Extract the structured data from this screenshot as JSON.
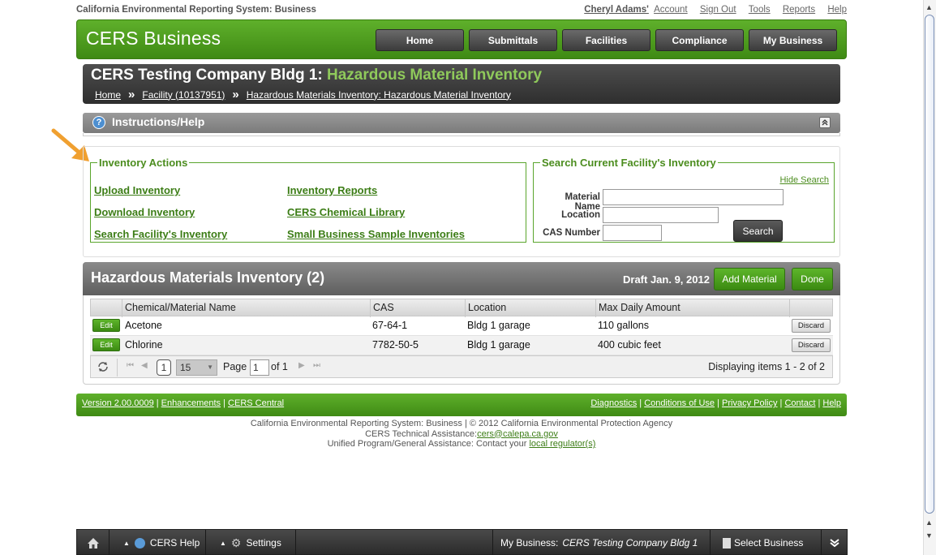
{
  "topbar": {
    "system": "California Environmental Reporting System: Business",
    "user_name": "Cheryl Adams'",
    "account": "Account",
    "sign_out": "Sign Out",
    "tools": "Tools",
    "reports": "Reports",
    "help": "Help"
  },
  "header": {
    "logo": "CERS Business",
    "nav": [
      "Home",
      "Submittals",
      "Facilities",
      "Compliance",
      "My Business"
    ]
  },
  "title": {
    "prefix": "CERS Testing Company Bldg 1:",
    "highlight": "Hazardous Material Inventory",
    "breadcrumb": [
      "Home",
      "Facility (10137951)",
      "Hazardous Materials Inventory: Hazardous Material Inventory"
    ],
    "sep": "»"
  },
  "instructions": {
    "label": "Instructions/Help",
    "q": "?",
    "collapse": "«"
  },
  "inventory_actions": {
    "legend": "Inventory Actions",
    "links": [
      "Upload Inventory",
      "Inventory Reports",
      "Download Inventory",
      "CERS Chemical Library",
      "Search Facility's Inventory",
      "Small Business Sample Inventories"
    ]
  },
  "search": {
    "legend": "Search Current Facility's Inventory",
    "hide": "Hide Search",
    "material_label": "Material Name",
    "location_label": "Location",
    "cas_label": "CAS Number",
    "button": "Search"
  },
  "inventory": {
    "title": "Hazardous Materials Inventory (2)",
    "draft": "Draft Jan. 9, 2012",
    "add_material": "Add Material",
    "done": "Done",
    "columns": [
      "Chemical/Material Name",
      "CAS",
      "Location",
      "Max Daily Amount"
    ],
    "edit_label": "Edit",
    "discard_label": "Discard",
    "rows": [
      {
        "name": "Acetone",
        "cas": "67-64-1",
        "location": "Bldg 1 garage",
        "amount": "110 gallons"
      },
      {
        "name": "Chlorine",
        "cas": "7782-50-5",
        "location": "Bldg 1 garage",
        "amount": "400 cubic feet"
      }
    ],
    "pager": {
      "current_page": "1",
      "page_size": "15",
      "page_label": "Page",
      "page_input": "1",
      "of_label": "of 1",
      "display": "Displaying items 1 - 2 of 2"
    }
  },
  "footer": {
    "version": "Version 2.00.0009",
    "enhancements": "Enhancements",
    "cers_central": "CERS Central",
    "diagnostics": "Diagnostics",
    "conditions": "Conditions of Use",
    "privacy": "Privacy Policy",
    "contact": "Contact",
    "help": "Help",
    "pipe": "|",
    "copy_line1": "California Environmental Reporting System: Business | © 2012 California Environmental Protection Agency",
    "copy_line2_prefix": "CERS Technical Assistance:",
    "copy_email": "cers@calepa.ca.gov",
    "copy_line3_prefix": "Unified Program/General Assistance: Contact your",
    "copy_regulator": "local regulator(s)"
  },
  "dock": {
    "cers_help": "CERS Help",
    "settings": "Settings",
    "my_business_label": "My Business:",
    "my_business_value": "CERS Testing Company Bldg 1",
    "select_business": "Select Business"
  },
  "colors": {
    "brand_green": "#4c9a1f",
    "highlight_green": "#8fc95b",
    "arrow_orange": "#f0a030"
  }
}
